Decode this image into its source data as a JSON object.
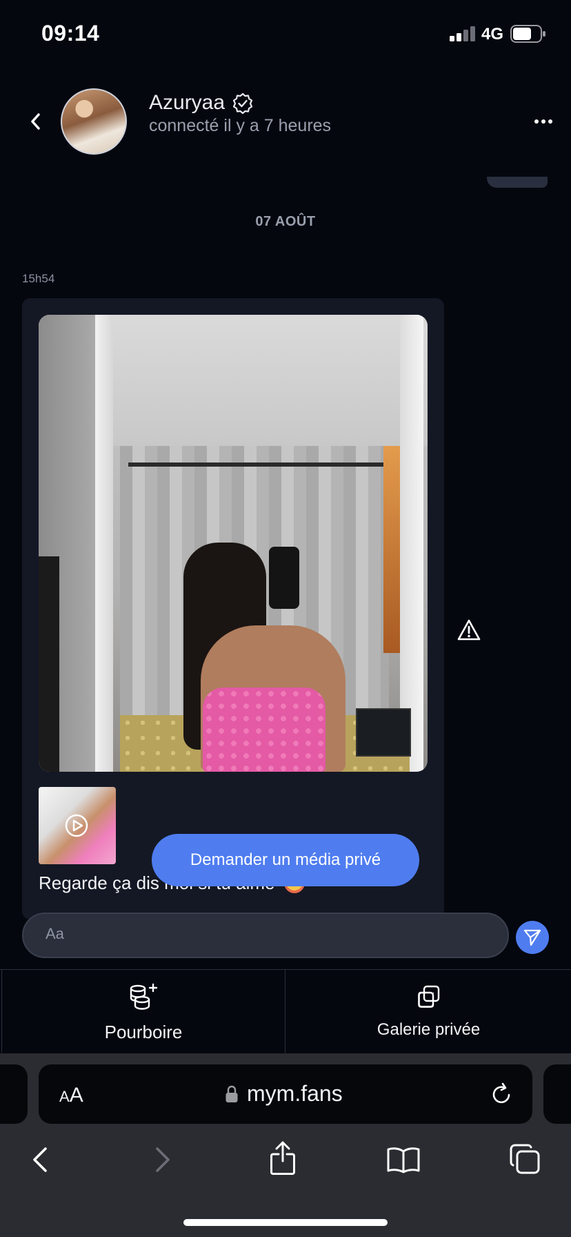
{
  "status_bar": {
    "time": "09:14",
    "network": "4G"
  },
  "header": {
    "creator_name": "Azuryaa",
    "creator_status": "connecté il y a 7 heures"
  },
  "conversation": {
    "date_separator": "07 AOÛT",
    "message": {
      "time": "15h54",
      "caption": "Regarde ça dis moi si tu aime"
    },
    "private_media_button": "Demander un média privé"
  },
  "composer": {
    "placeholder": "Aa"
  },
  "actions": {
    "tip_label": "Pourboire",
    "gallery_label": "Galerie privée"
  },
  "browser": {
    "text_size_large": "A",
    "text_size_small": "A",
    "url": "mym.fans"
  },
  "colors": {
    "background": "#05070f",
    "accent": "#4f7df0",
    "bubble": "#141824",
    "secondary_text": "#9aa0ad"
  }
}
